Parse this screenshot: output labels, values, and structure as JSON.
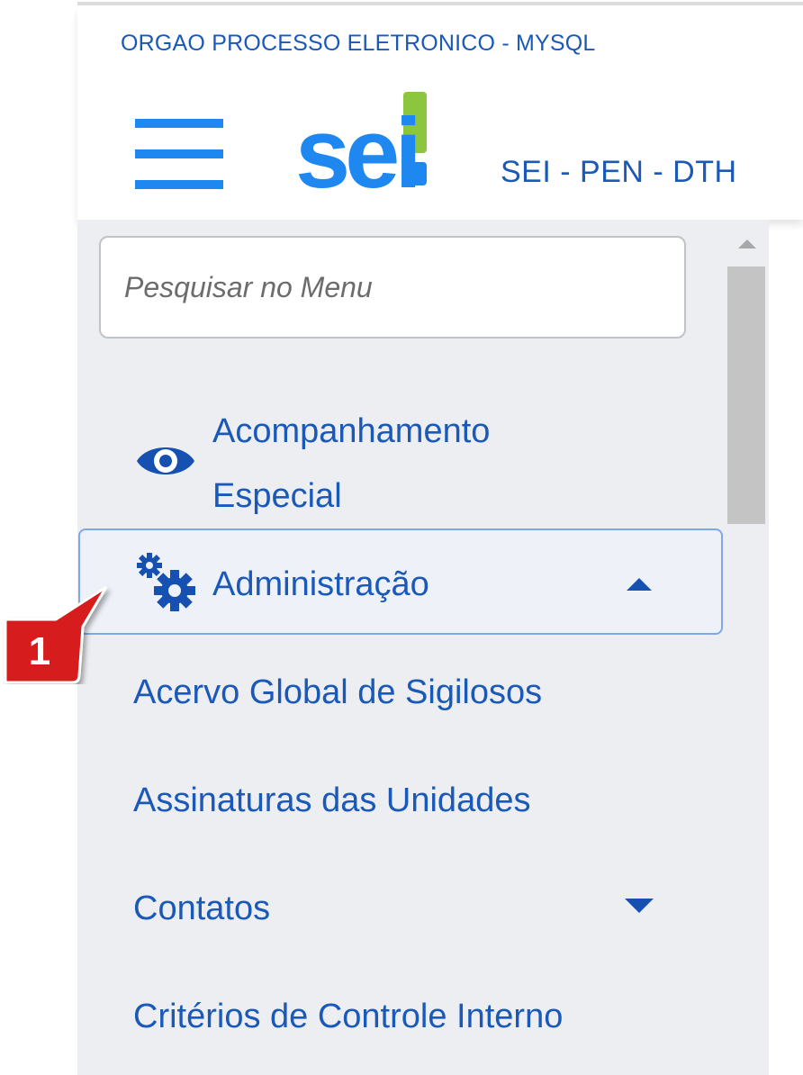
{
  "header": {
    "org_name": "ORGAO PROCESSO ELETRONICO - MYSQL",
    "system_name": "SEI - PEN - DTH",
    "logo_text": "sei!",
    "menu_icon": "hamburger-menu-icon",
    "brand_colors": {
      "blue": "#1e88f0",
      "green": "#8cc63e",
      "text": "#1a59b8"
    }
  },
  "search": {
    "placeholder": "Pesquisar no Menu",
    "value": ""
  },
  "menu": {
    "items": [
      {
        "label_line1": "Acompanhamento",
        "label_line2": "Especial",
        "icon": "eye-icon"
      },
      {
        "label": "Administração",
        "icon": "gears-icon",
        "expanded": true,
        "caret": "caret-up-icon"
      }
    ],
    "subitems": [
      {
        "label": "Acervo Global de Sigilosos"
      },
      {
        "label": "Assinaturas das Unidades"
      },
      {
        "label": "Contatos",
        "has_children": true,
        "caret": "caret-down-icon"
      },
      {
        "label": "Critérios de Controle Interno"
      }
    ],
    "selected_border_color": "#7ea8e6"
  },
  "annotation": {
    "number": "1",
    "color": "#d61a1a"
  }
}
